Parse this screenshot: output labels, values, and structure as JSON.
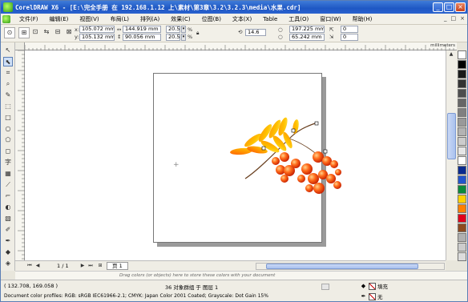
{
  "window": {
    "title": "CorelDRAW X6 - [E:\\完全手册 在 192.168.1.12 上\\素材\\第3章\\3.2\\3.2.3\\media\\水果.cdr]",
    "controls": [
      "_",
      "□",
      "×"
    ]
  },
  "menu": {
    "items": [
      "文件(F)",
      "编辑(E)",
      "视图(V)",
      "布局(L)",
      "排列(A)",
      "效果(C)",
      "位图(B)",
      "文本(X)",
      "Table",
      "工具(O)",
      "窗口(W)",
      "帮助(H)"
    ],
    "right_controls": [
      "_",
      "□",
      "×"
    ]
  },
  "property_bar": {
    "x_label": "x:",
    "x_value": "105.072 mm",
    "y_label": "y:",
    "y_value": "105.132 mm",
    "w_value": "144.919 mm",
    "h_value": "90.056 mm",
    "scale_x": "20.5",
    "scale_y": "20.5",
    "percent": "%",
    "rotation": "14.6",
    "pos_x": "197.225 mm",
    "pos_y": "65.242 mm",
    "angle1": "0",
    "angle2": "0"
  },
  "ruler": {
    "unit": "millimeters"
  },
  "page_bar": {
    "page_count": "1 / 1",
    "page_tab": "页 1"
  },
  "document_palette": {
    "hint": "Drag colors (or objects) here to store these colors with your document"
  },
  "status": {
    "coords": "( 132.708, 169.058 )",
    "selection": "36 对象群组 于 图层 1",
    "color_profile": "Document color profiles: RGB: sRGB IEC61966-2.1; CMYK: Japan Color 2001 Coated; Grayscale: Dot Gain 15%",
    "fill_label": "填充",
    "outline_label": "无"
  },
  "palette_colors": [
    "#ffffff",
    "#000000",
    "#1a1a1a",
    "#333333",
    "#4d4d4d",
    "#666666",
    "#808080",
    "#999999",
    "#b3b3b3",
    "#cccccc",
    "#e6e6e6",
    "#ffffff",
    "#0a2b8f",
    "#2255cc",
    "#0b8a3a",
    "#ffd000",
    "#ff7f00",
    "#e0001b",
    "#8e4a1f",
    "#b0b0b0",
    "#cccccc",
    "#dcdcdc"
  ]
}
